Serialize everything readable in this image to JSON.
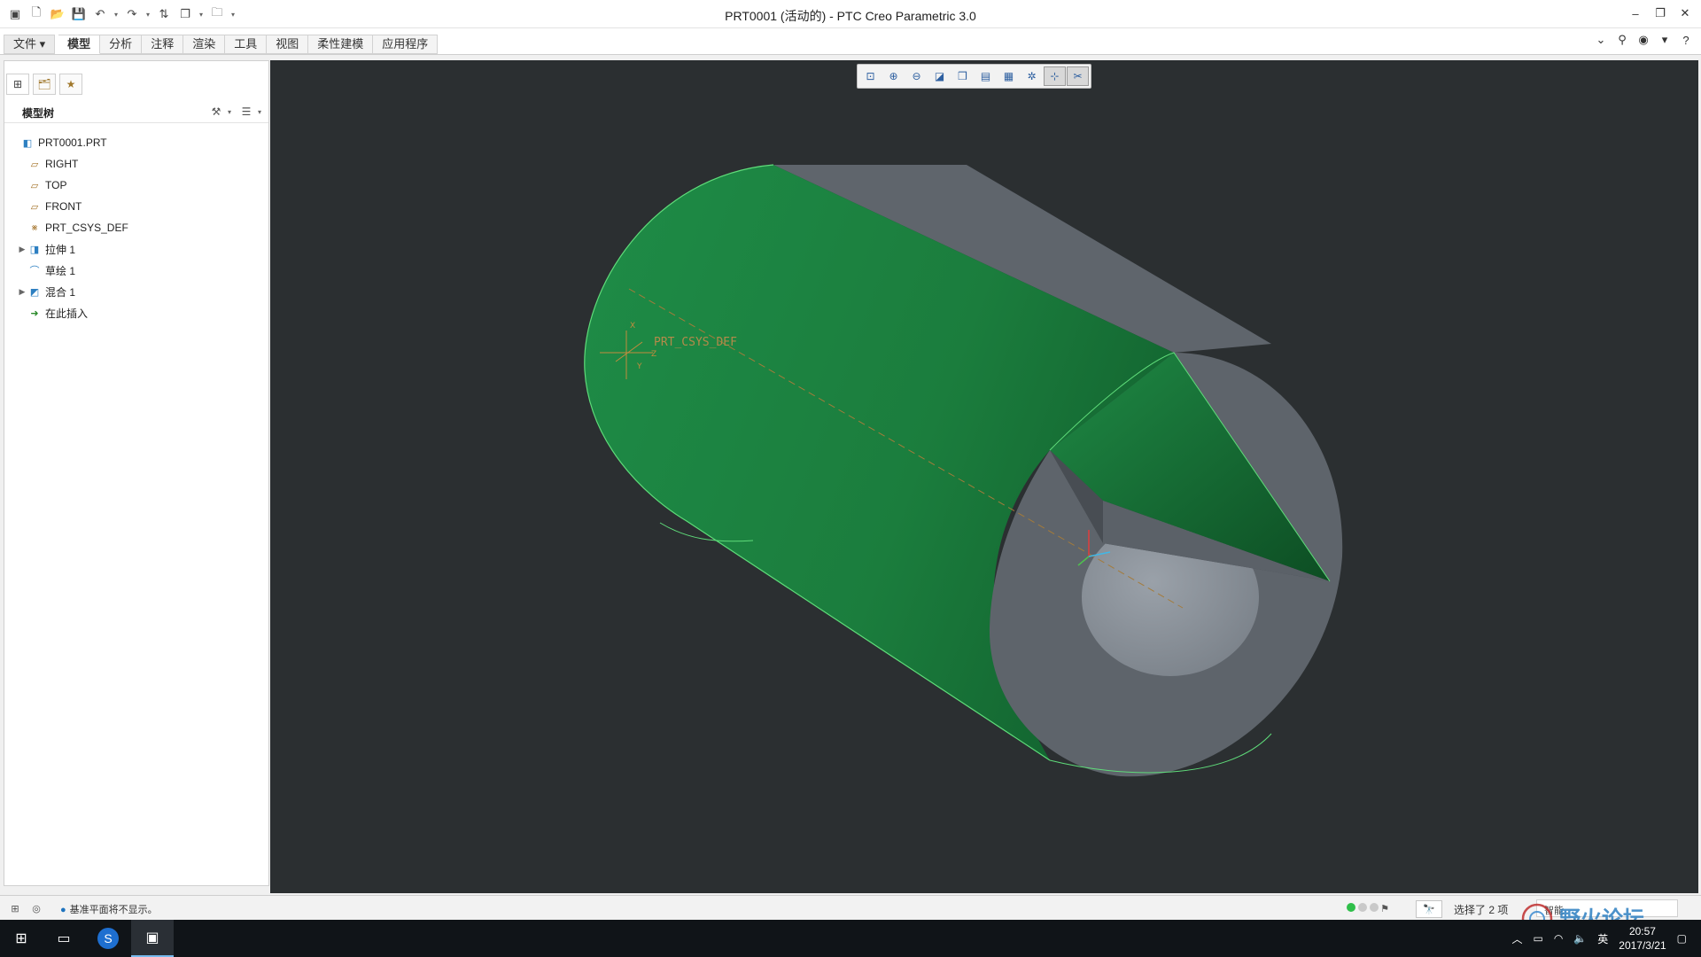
{
  "window": {
    "title": "PRT0001 (活动的) - PTC Creo Parametric 3.0"
  },
  "ribbon": {
    "file_label": "文件",
    "tabs": [
      {
        "label": "模型",
        "active": true
      },
      {
        "label": "分析"
      },
      {
        "label": "注释"
      },
      {
        "label": "渲染"
      },
      {
        "label": "工具"
      },
      {
        "label": "视图"
      },
      {
        "label": "柔性建模"
      },
      {
        "label": "应用程序"
      }
    ]
  },
  "navigator": {
    "tree_title": "模型树",
    "items": [
      {
        "label": "PRT0001.PRT",
        "icon": "part-icon",
        "expandable": false
      },
      {
        "label": "RIGHT",
        "icon": "datum-plane-icon",
        "expandable": false
      },
      {
        "label": "TOP",
        "icon": "datum-plane-icon",
        "expandable": false
      },
      {
        "label": "FRONT",
        "icon": "datum-plane-icon",
        "expandable": false
      },
      {
        "label": "PRT_CSYS_DEF",
        "icon": "coordinate-system-icon",
        "expandable": false
      },
      {
        "label": "拉伸 1",
        "icon": "extrude-icon",
        "expandable": true
      },
      {
        "label": "草绘 1",
        "icon": "sketch-icon",
        "expandable": false
      },
      {
        "label": "混合 1",
        "icon": "blend-icon",
        "expandable": true
      },
      {
        "label": "在此插入",
        "icon": "insert-here-icon",
        "expandable": false
      }
    ]
  },
  "viewport": {
    "csys_label": "PRT_CSYS_DEF",
    "background_color": "#2b2f31",
    "model_green": "#1f8a45",
    "model_gray": "#5e646b"
  },
  "status": {
    "message": "基准平面将不显示。",
    "selection": "选择了 2 项",
    "filter": "智能"
  },
  "watermark": {
    "text": "野火论坛"
  },
  "taskbar": {
    "ime": "英",
    "time": "20:57",
    "date": "2017/3/21"
  }
}
